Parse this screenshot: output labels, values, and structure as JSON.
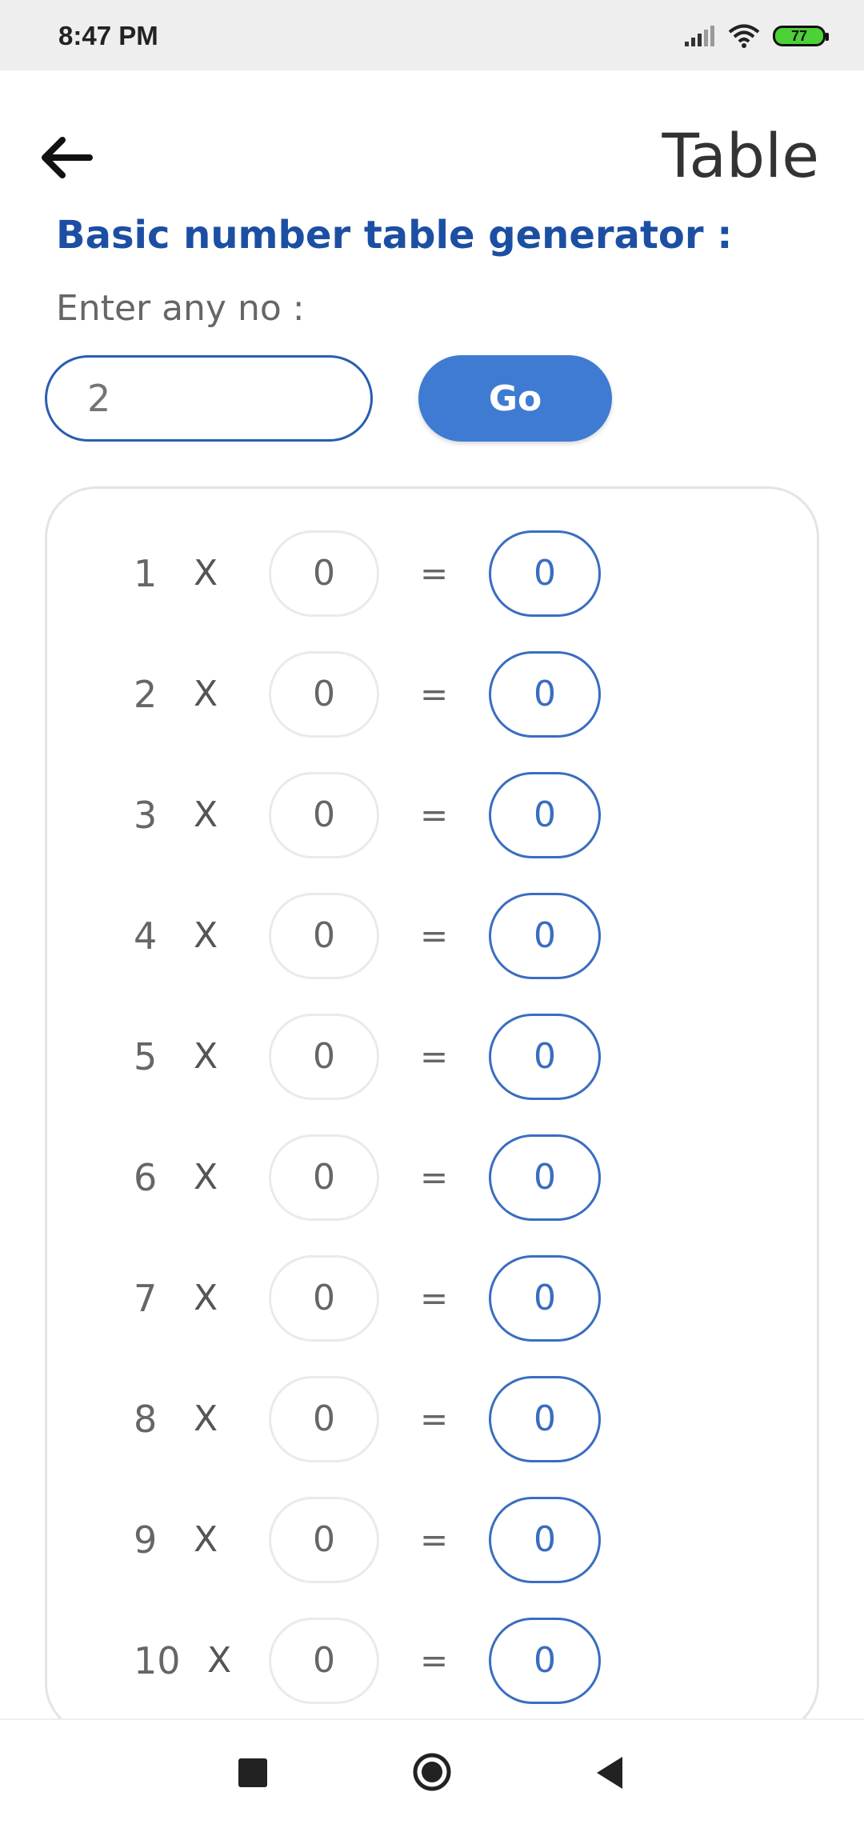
{
  "status_bar": {
    "time": "8:47 PM",
    "battery": "77"
  },
  "header": {
    "title": "Table",
    "back_icon": "arrow-left-icon"
  },
  "form": {
    "subtitle": "Basic number table generator :",
    "prompt": "Enter any no :",
    "input_placeholder": "2",
    "go_label": "Go"
  },
  "table": {
    "operator": "X",
    "equals": "=",
    "rows": [
      {
        "n": "1",
        "value": "0",
        "result": "0"
      },
      {
        "n": "2",
        "value": "0",
        "result": "0"
      },
      {
        "n": "3",
        "value": "0",
        "result": "0"
      },
      {
        "n": "4",
        "value": "0",
        "result": "0"
      },
      {
        "n": "5",
        "value": "0",
        "result": "0"
      },
      {
        "n": "6",
        "value": "0",
        "result": "0"
      },
      {
        "n": "7",
        "value": "0",
        "result": "0"
      },
      {
        "n": "8",
        "value": "0",
        "result": "0"
      },
      {
        "n": "9",
        "value": "0",
        "result": "0"
      },
      {
        "n": "10",
        "value": "0",
        "result": "0"
      }
    ]
  },
  "colors": {
    "accent": "#3f7bd2",
    "subtitle": "#1c4fa3",
    "result_border": "#3a6dc0"
  }
}
